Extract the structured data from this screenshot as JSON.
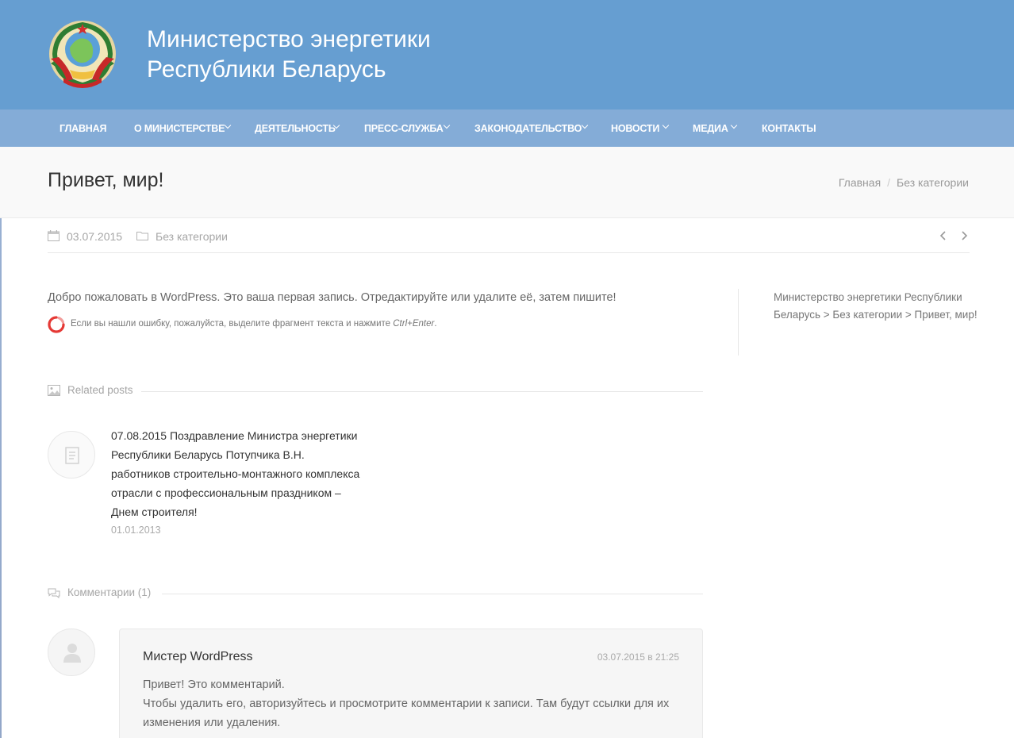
{
  "header": {
    "title_line1": "Министерство энергетики",
    "title_line2": "Республики Беларусь",
    "emblem_icon": "belarus-coat-of-arms",
    "colors": {
      "header_bg": "#669ed1",
      "nav_bg": "#84acd7"
    }
  },
  "nav": {
    "items": [
      {
        "label": "ГЛАВНАЯ",
        "has_dropdown": false
      },
      {
        "label": "О МИНИСТЕРСТВЕ",
        "has_dropdown": true
      },
      {
        "label": "ДЕЯТЕЛЬНОСТЬ",
        "has_dropdown": true
      },
      {
        "label": "ПРЕСС-СЛУЖБА",
        "has_dropdown": true
      },
      {
        "label": "ЗАКОНОДАТЕЛЬСТВО",
        "has_dropdown": true
      },
      {
        "label": "НОВОСТИ",
        "has_dropdown": true
      },
      {
        "label": "МЕДИА",
        "has_dropdown": true
      },
      {
        "label": "КОНТАКТЫ",
        "has_dropdown": false
      }
    ]
  },
  "page": {
    "title": "Привет, мир!",
    "breadcrumbs": [
      "Главная",
      "Без категории"
    ],
    "breadcrumb_separator": "/"
  },
  "post_meta": {
    "date": "03.07.2015",
    "category": "Без категории",
    "date_icon": "calendar-icon",
    "category_icon": "folder-icon"
  },
  "post": {
    "content": "Добро пожаловать в WordPress. Это ваша первая запись. Отредактируйте или удалите её, затем пишите!",
    "orphus_text": "Если вы нашли ошибку, пожалуйста, выделите фрагмент текста и нажмите",
    "orphus_keys": "Ctrl+Enter",
    "orphus_suffix": "."
  },
  "sidebar": {
    "breadcrumb_text": "Министерство энергетики Республики Беларусь > Без категории > Привет, мир!"
  },
  "related": {
    "heading": "Related posts",
    "items": [
      {
        "title": "07.08.2015 Поздравление Министра энергетики Республики Беларусь Потупчика В.Н. работников строительно-монтажного комплекса отрасли с профессиональным праздником – Днем строителя!",
        "date": "01.01.2013"
      }
    ]
  },
  "comments": {
    "heading": "Комментарии (1)",
    "items": [
      {
        "author": "Мистер WordPress",
        "date": "03.07.2015 в 21:25",
        "line1": "Привет! Это комментарий.",
        "line2": "Чтобы удалить его, авторизуйтесь и просмотрите комментарии к записи. Там будут ссылки для их изменения или удаления."
      }
    ]
  }
}
